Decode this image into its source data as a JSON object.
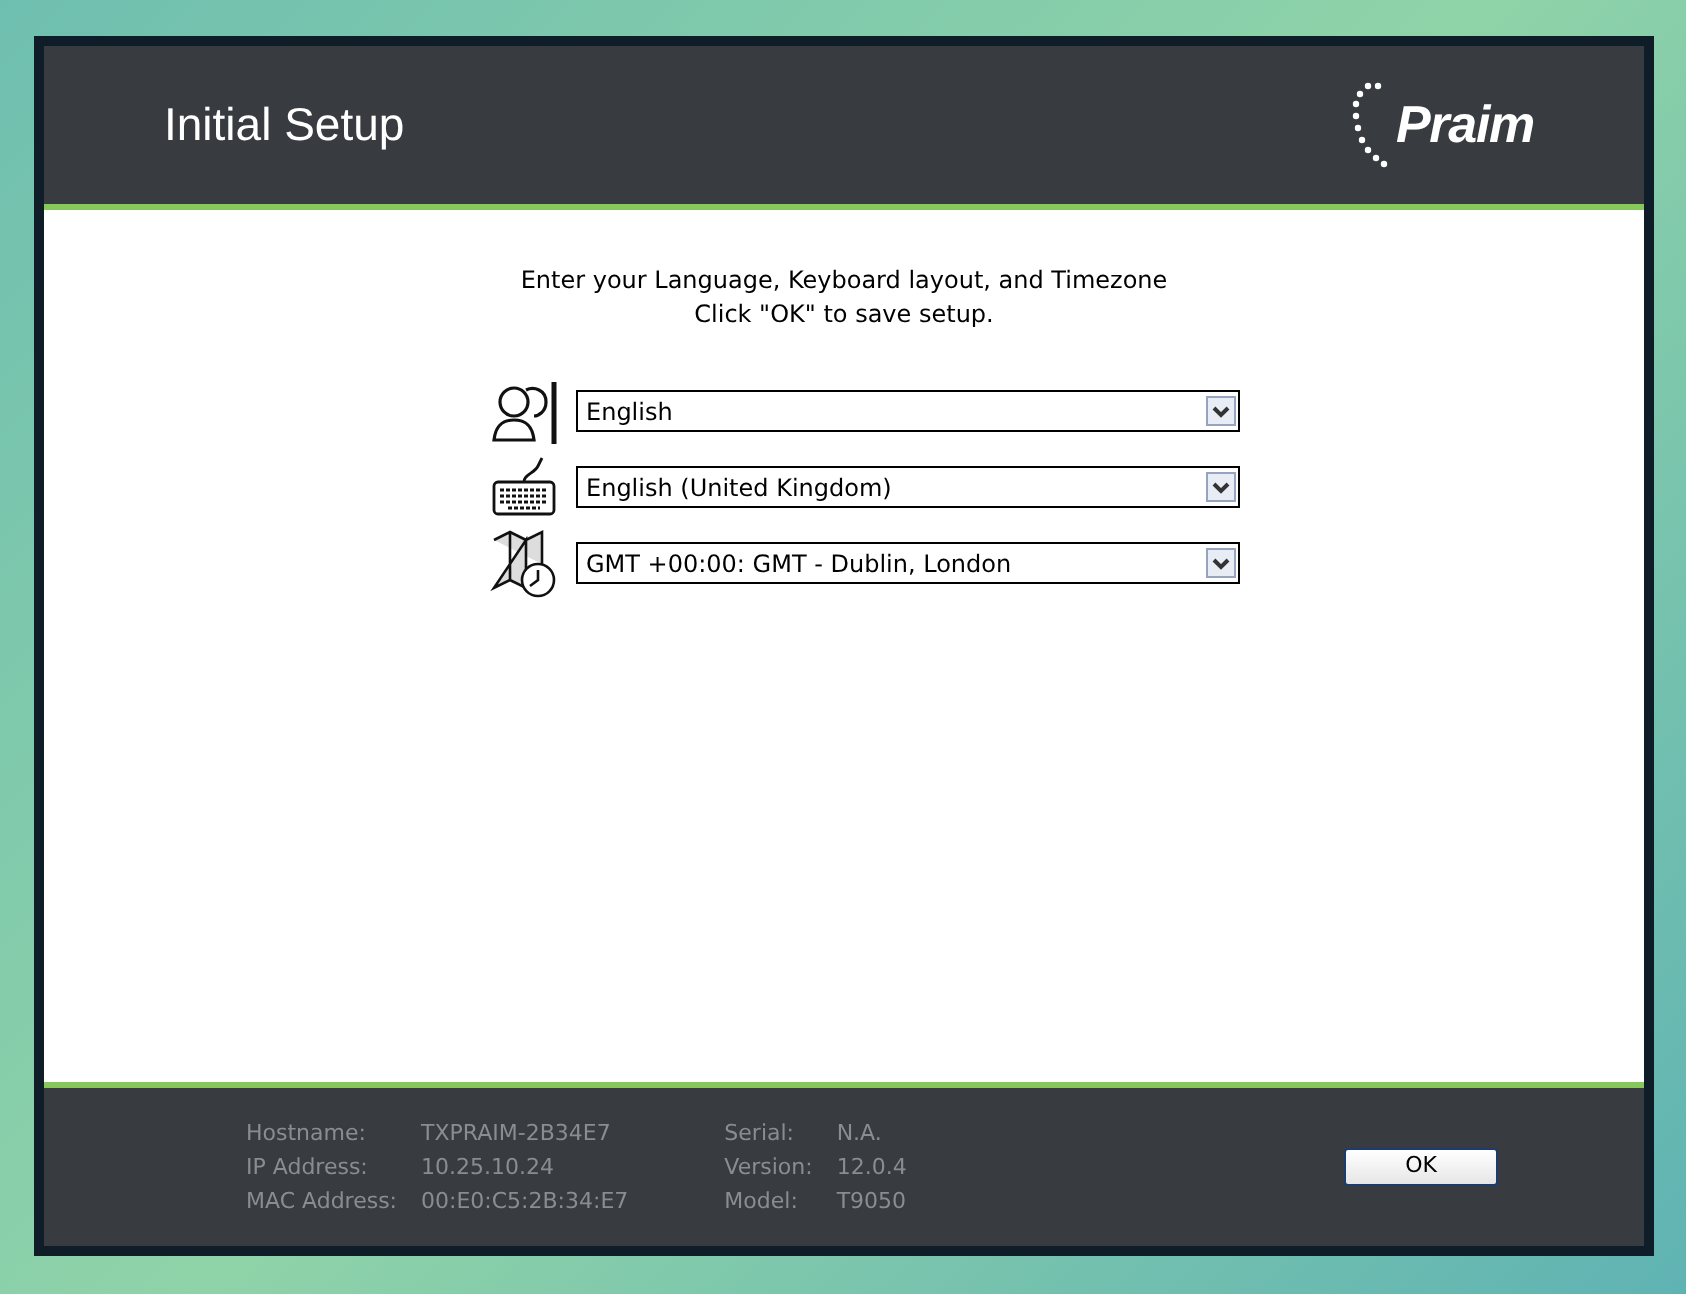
{
  "header": {
    "title": "Initial Setup",
    "logo_text": "Praim"
  },
  "instructions": [
    "Enter your Language, Keyboard layout, and Timezone",
    "Click \"OK\" to save setup."
  ],
  "fields": [
    {
      "kind": "language",
      "value": "English"
    },
    {
      "kind": "keyboard",
      "value": "English (United Kingdom)"
    },
    {
      "kind": "timezone",
      "value": "GMT +00:00: GMT - Dublin, London"
    }
  ],
  "info_left": [
    {
      "label": "Hostname:",
      "value": "TXPRAIM-2B34E7"
    },
    {
      "label": "IP Address:",
      "value": "10.25.10.24"
    },
    {
      "label": "MAC Address:",
      "value": "00:E0:C5:2B:34:E7"
    }
  ],
  "info_right": [
    {
      "label": "Serial:",
      "value": "N.A."
    },
    {
      "label": "Version:",
      "value": "12.0.4"
    },
    {
      "label": "Model:",
      "value": "T9050"
    }
  ],
  "ok_button": "OK"
}
